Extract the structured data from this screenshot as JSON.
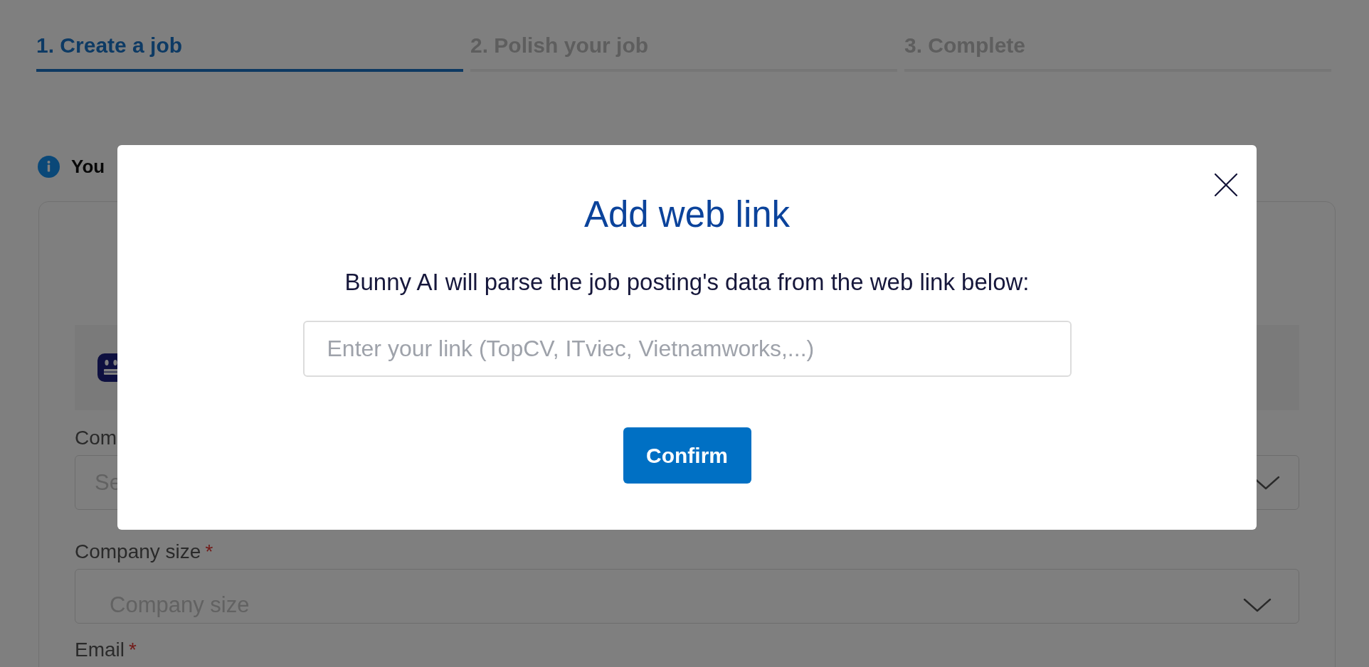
{
  "steps": [
    {
      "label": "1. Create a job",
      "selected": true
    },
    {
      "label": "2. Polish your job",
      "selected": false
    },
    {
      "label": "3. Complete",
      "selected": false
    }
  ],
  "notice": {
    "text": "You"
  },
  "form": {
    "fields": [
      {
        "label": "Com",
        "select": {
          "kind": "combobox",
          "placeholder": "Se"
        }
      },
      {
        "label": "Company size",
        "required_mark": "*",
        "select": {
          "kind": "select",
          "placeholder": "Company size"
        }
      },
      {
        "label": "Email",
        "required_mark": "*"
      }
    ]
  },
  "modal": {
    "title": "Add web link",
    "description": "Bunny AI will parse the job posting's data from the web link below:",
    "link_field": {
      "placeholder": "Enter your link (TopCV, ITviec, Vietnamworks,...)"
    },
    "confirm_button": "Confirm"
  }
}
